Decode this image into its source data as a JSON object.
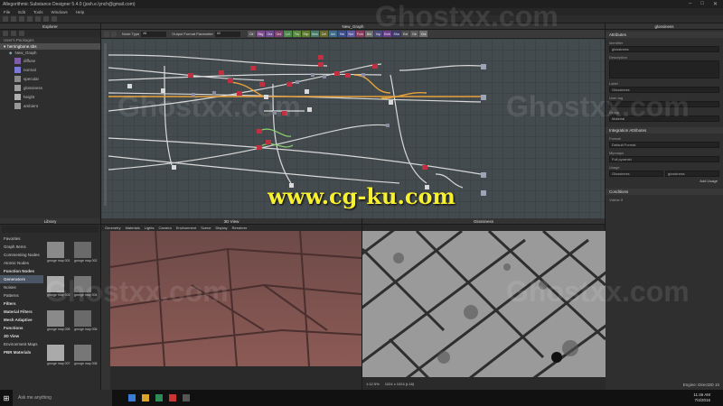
{
  "app": {
    "title": "Allegorithmic Substance Designer 5.4.0 (josh.e.lynch@gmail.com)",
    "menu": [
      "File",
      "Edit",
      "Tools",
      "Windows",
      "Help"
    ]
  },
  "explorer": {
    "title": "Explorer",
    "header": "User's Packages",
    "package": "herringbone.sbs",
    "graph": "New_Graph",
    "outputs": [
      {
        "label": "diffuse",
        "color": "#7b5ea7"
      },
      {
        "label": "normal",
        "color": "#7a7ad6"
      },
      {
        "label": "specular",
        "color": "#8a8a8a"
      },
      {
        "label": "glossiness",
        "color": "#9e9e9e"
      },
      {
        "label": "height",
        "color": "#b0b0b0"
      },
      {
        "label": "ambient",
        "color": "#9a9a9a"
      }
    ]
  },
  "graph": {
    "title": "New_Graph",
    "explore_label": "Node Type",
    "explore_value": "All",
    "output_label": "Output Format Parameter",
    "output_value": "All",
    "filters": [
      {
        "label": "Clr",
        "color": "#555555"
      },
      {
        "label": "Bkg",
        "color": "#7d4b8c"
      },
      {
        "label": "Gra",
        "color": "#6b4b8c"
      },
      {
        "label": "Grd",
        "color": "#7a3f6e"
      },
      {
        "label": "Lvl",
        "color": "#4d8a4d"
      },
      {
        "label": "Trs",
        "color": "#5a8a3d"
      },
      {
        "label": "Shp",
        "color": "#5e7a2d"
      },
      {
        "label": "Nrm",
        "color": "#4a7a6a"
      },
      {
        "label": "Cel",
        "color": "#6a6a2d"
      },
      {
        "label": "Uni",
        "color": "#3d6b8a"
      },
      {
        "label": "Hsl",
        "color": "#3b4e8c"
      },
      {
        "label": "Nor",
        "color": "#5b5ba0"
      },
      {
        "label": "Fxm",
        "color": "#8a3d5e"
      },
      {
        "label": "Bld",
        "color": "#6b6b6b"
      },
      {
        "label": "Inp",
        "color": "#4b4b7a"
      },
      {
        "label": "Emb",
        "color": "#6b3d8a"
      },
      {
        "label": "Sha",
        "color": "#3d3d6b"
      },
      {
        "label": "Ext",
        "color": "#4d4d4d"
      },
      {
        "label": "Dir",
        "color": "#5a5a5a"
      },
      {
        "label": "Out",
        "color": "#6e6e6e"
      }
    ]
  },
  "attributes": {
    "title": "glossiness",
    "section_attributes": "Attributes",
    "identifier_label": "Identifier",
    "identifier_value": "glossiness",
    "description_label": "Description",
    "label_label": "Label",
    "label_value": "Glossiness",
    "usage_label": "User tag",
    "group_label": "Group",
    "group_value": "Material",
    "section_integration": "Integration Attributes",
    "format_label": "Format",
    "format_value": "Default Format",
    "mipmaps_label": "Mipmaps",
    "mipmaps_value": "Full pyramid",
    "usage_row_label": "Usage",
    "usage_value": "Glossiness",
    "usage_channel": "glossiness",
    "add_label": "Add Usage",
    "section_conditions": "Conditions",
    "visible_label": "Visible If"
  },
  "library": {
    "title": "Library",
    "items": [
      {
        "label": "Favorites",
        "cat": false
      },
      {
        "label": "Graph Items",
        "cat": false
      },
      {
        "label": "Commenting Nodes",
        "cat": false
      },
      {
        "label": "Atomic Nodes",
        "cat": false
      },
      {
        "label": "Function Nodes",
        "cat": true
      },
      {
        "label": "Generators",
        "cat": true
      },
      {
        "label": "Noises",
        "cat": false
      },
      {
        "label": "Patterns",
        "cat": false
      },
      {
        "label": "Filters",
        "cat": true
      },
      {
        "label": "Material Filters",
        "cat": true
      },
      {
        "label": "Mesh Adaptive",
        "cat": true
      },
      {
        "label": "Functions",
        "cat": true
      },
      {
        "label": "3D View",
        "cat": true
      },
      {
        "label": "Environment Maps",
        "cat": false
      },
      {
        "label": "PBR Materials",
        "cat": true
      }
    ],
    "thumb_labels": [
      "grunge map 001",
      "grunge map 002",
      "grunge map 003",
      "grunge map 004",
      "grunge map 005",
      "grunge map 006",
      "grunge map 007",
      "grunge map 008"
    ]
  },
  "view3d": {
    "title": "3D View",
    "menu": [
      "Geometry",
      "Materials",
      "Lights",
      "Camera",
      "Environment",
      "Scene",
      "Display",
      "Renderer"
    ]
  },
  "view2d": {
    "title": "Glossiness",
    "zoom": "1:12.5%",
    "res": "1024 x 1024 (L16)"
  },
  "engine": "Engine: Direct3D 10",
  "taskbar": {
    "search": "Ask me anything",
    "time": "11:46 AM",
    "date": "7/4/2016"
  },
  "watermarks": {
    "site": "www.cg-ku.com",
    "ghost": "Ghostxx.com"
  }
}
